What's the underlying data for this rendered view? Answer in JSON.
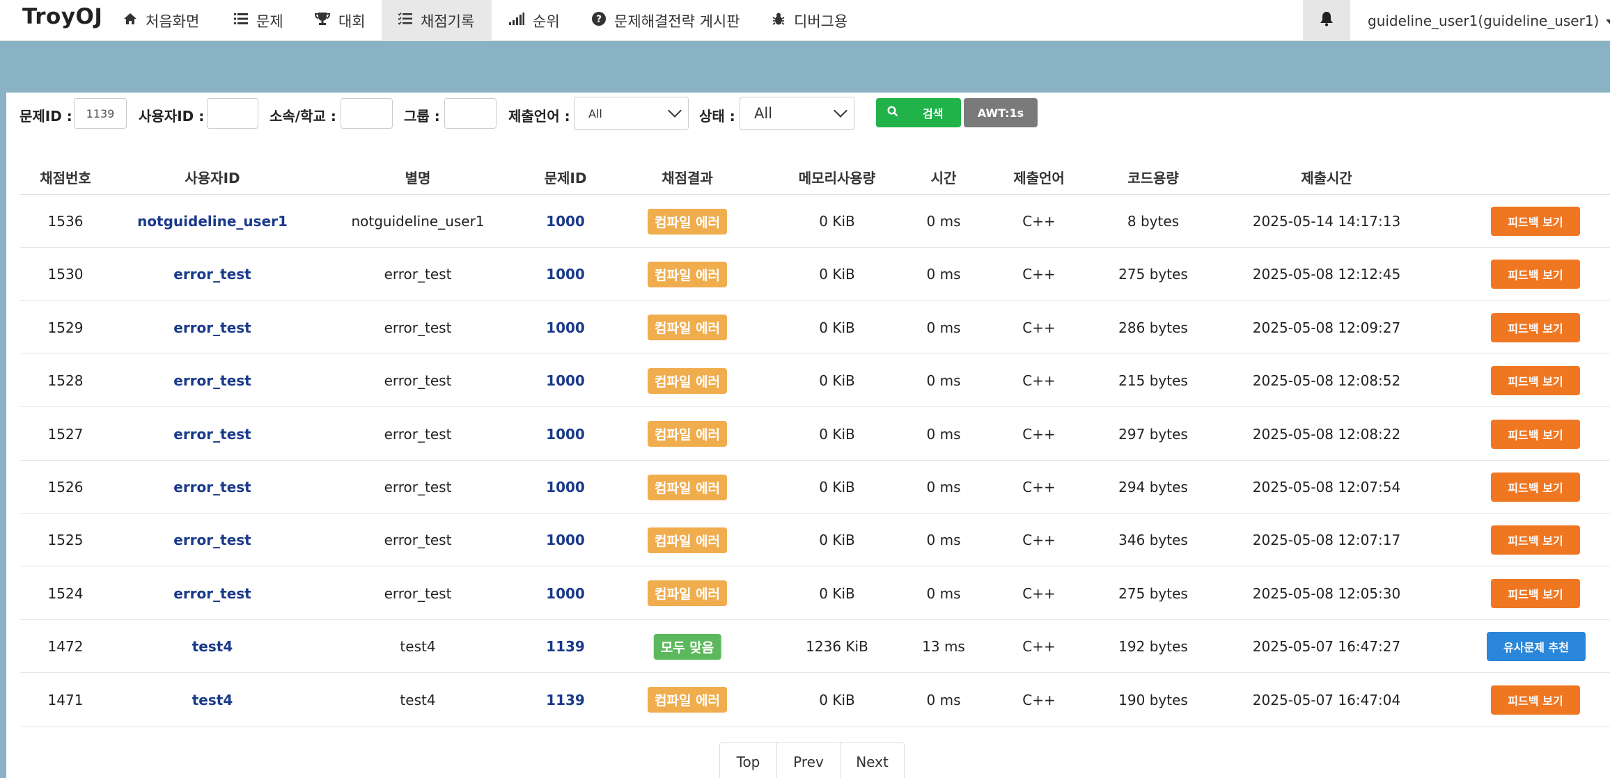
{
  "nav": {
    "brand": "TroyOJ",
    "items": [
      {
        "label": "처음화면",
        "icon": "home-icon",
        "glyph": "⌂"
      },
      {
        "label": "문제",
        "icon": "list-icon",
        "glyph": "☰"
      },
      {
        "label": "대회",
        "icon": "trophy-icon",
        "glyph": "🏆"
      },
      {
        "label": "채점기록",
        "icon": "tasks-icon",
        "glyph": "☷"
      },
      {
        "label": "순위",
        "icon": "signal-icon",
        "glyph": "▂▄▆"
      },
      {
        "label": "문제해결전략 게시판",
        "icon": "question-circle-icon",
        "glyph": "?"
      },
      {
        "label": "디버그용",
        "icon": "bug-icon",
        "glyph": "✱"
      }
    ],
    "active_index": 3,
    "user_label": "guideline_user1(guideline_user1)"
  },
  "filters": {
    "problem_id_label": "문제ID :",
    "problem_id_value": "1139",
    "user_id_label": "사용자ID :",
    "user_id_value": "",
    "school_label": "소속/학교 :",
    "school_value": "",
    "group_label": "그룹 :",
    "group_value": "",
    "language_label": "제출언어 :",
    "language_value": "All",
    "status_label": "상태 :",
    "status_value": "All",
    "search_label": "검색",
    "awt_label": "AWT:1s"
  },
  "table": {
    "headers": [
      "채점번호",
      "사용자ID",
      "별명",
      "문제ID",
      "채점결과",
      "메모리사용량",
      "시간",
      "제출언어",
      "코드용량",
      "제출시간"
    ],
    "rows": [
      {
        "id": "1536",
        "user": "notguideline_user1",
        "nick": "notguideline_user1",
        "problem": "1000",
        "result": "컴파일 에러",
        "result_type": "ce",
        "memory": "0 KiB",
        "time": "0 ms",
        "lang": "C++",
        "size": "8 bytes",
        "submitted": "2025-05-14 14:17:13",
        "action": "피드백 보기",
        "action_type": "feedback"
      },
      {
        "id": "1530",
        "user": "error_test",
        "nick": "error_test",
        "problem": "1000",
        "result": "컴파일 에러",
        "result_type": "ce",
        "memory": "0 KiB",
        "time": "0 ms",
        "lang": "C++",
        "size": "275 bytes",
        "submitted": "2025-05-08 12:12:45",
        "action": "피드백 보기",
        "action_type": "feedback"
      },
      {
        "id": "1529",
        "user": "error_test",
        "nick": "error_test",
        "problem": "1000",
        "result": "컴파일 에러",
        "result_type": "ce",
        "memory": "0 KiB",
        "time": "0 ms",
        "lang": "C++",
        "size": "286 bytes",
        "submitted": "2025-05-08 12:09:27",
        "action": "피드백 보기",
        "action_type": "feedback"
      },
      {
        "id": "1528",
        "user": "error_test",
        "nick": "error_test",
        "problem": "1000",
        "result": "컴파일 에러",
        "result_type": "ce",
        "memory": "0 KiB",
        "time": "0 ms",
        "lang": "C++",
        "size": "215 bytes",
        "submitted": "2025-05-08 12:08:52",
        "action": "피드백 보기",
        "action_type": "feedback"
      },
      {
        "id": "1527",
        "user": "error_test",
        "nick": "error_test",
        "problem": "1000",
        "result": "컴파일 에러",
        "result_type": "ce",
        "memory": "0 KiB",
        "time": "0 ms",
        "lang": "C++",
        "size": "297 bytes",
        "submitted": "2025-05-08 12:08:22",
        "action": "피드백 보기",
        "action_type": "feedback"
      },
      {
        "id": "1526",
        "user": "error_test",
        "nick": "error_test",
        "problem": "1000",
        "result": "컴파일 에러",
        "result_type": "ce",
        "memory": "0 KiB",
        "time": "0 ms",
        "lang": "C++",
        "size": "294 bytes",
        "submitted": "2025-05-08 12:07:54",
        "action": "피드백 보기",
        "action_type": "feedback"
      },
      {
        "id": "1525",
        "user": "error_test",
        "nick": "error_test",
        "problem": "1000",
        "result": "컴파일 에러",
        "result_type": "ce",
        "memory": "0 KiB",
        "time": "0 ms",
        "lang": "C++",
        "size": "346 bytes",
        "submitted": "2025-05-08 12:07:17",
        "action": "피드백 보기",
        "action_type": "feedback"
      },
      {
        "id": "1524",
        "user": "error_test",
        "nick": "error_test",
        "problem": "1000",
        "result": "컴파일 에러",
        "result_type": "ce",
        "memory": "0 KiB",
        "time": "0 ms",
        "lang": "C++",
        "size": "275 bytes",
        "submitted": "2025-05-08 12:05:30",
        "action": "피드백 보기",
        "action_type": "feedback"
      },
      {
        "id": "1472",
        "user": "test4",
        "nick": "test4",
        "problem": "1139",
        "result": "모두 맞음",
        "result_type": "ac",
        "memory": "1236 KiB",
        "time": "13 ms",
        "lang": "C++",
        "size": "192 bytes",
        "submitted": "2025-05-07 16:47:27",
        "action": "유사문제 추천",
        "action_type": "similar"
      },
      {
        "id": "1471",
        "user": "test4",
        "nick": "test4",
        "problem": "1139",
        "result": "컴파일 에러",
        "result_type": "ce",
        "memory": "0 KiB",
        "time": "0 ms",
        "lang": "C++",
        "size": "190 bytes",
        "submitted": "2025-05-07 16:47:04",
        "action": "피드백 보기",
        "action_type": "feedback"
      }
    ]
  },
  "pagination": {
    "labels": [
      "Top",
      "Prev",
      "Next"
    ]
  },
  "colors": {
    "band": "#89b2c4",
    "compile_error": "#f0ad4e",
    "accepted": "#5cb85c",
    "feedback_button": "#f07722",
    "similar_button": "#2a86d8",
    "search_button": "#21b24a",
    "awt_button": "#7a7a7a",
    "link": "#1a3a8a"
  }
}
